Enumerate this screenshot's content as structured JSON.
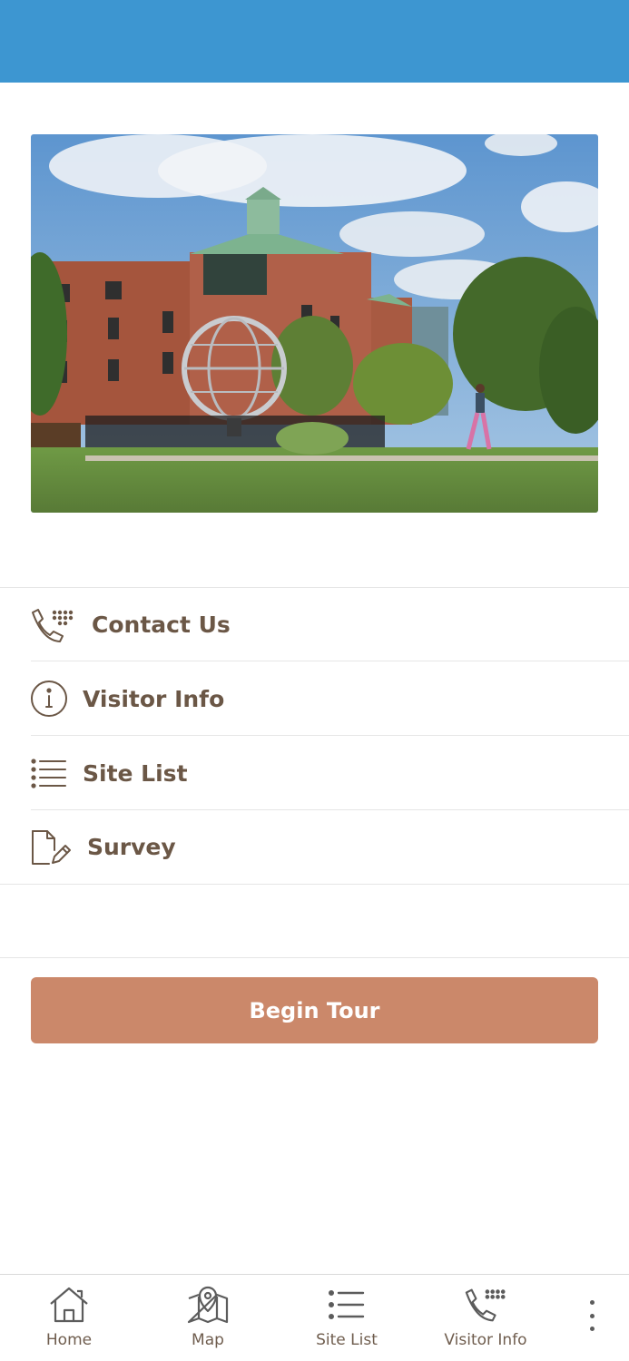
{
  "colors": {
    "top_bar": "#3d96d1",
    "accent_button": "#cb886a",
    "menu_text": "#6b5746"
  },
  "menu": [
    {
      "label": "Contact Us",
      "icon": "phone-dialpad-icon"
    },
    {
      "label": "Visitor Info",
      "icon": "info-circle-icon"
    },
    {
      "label": "Site List",
      "icon": "list-icon"
    },
    {
      "label": "Survey",
      "icon": "document-edit-icon"
    }
  ],
  "primary_action": {
    "label": "Begin Tour"
  },
  "bottom_nav": [
    {
      "label": "Home",
      "icon": "home-icon"
    },
    {
      "label": "Map",
      "icon": "map-pin-icon"
    },
    {
      "label": "Site List",
      "icon": "list-icon"
    },
    {
      "label": "Visitor Info",
      "icon": "phone-dialpad-icon"
    }
  ],
  "more_menu": {
    "icon": "more-vertical-icon"
  }
}
